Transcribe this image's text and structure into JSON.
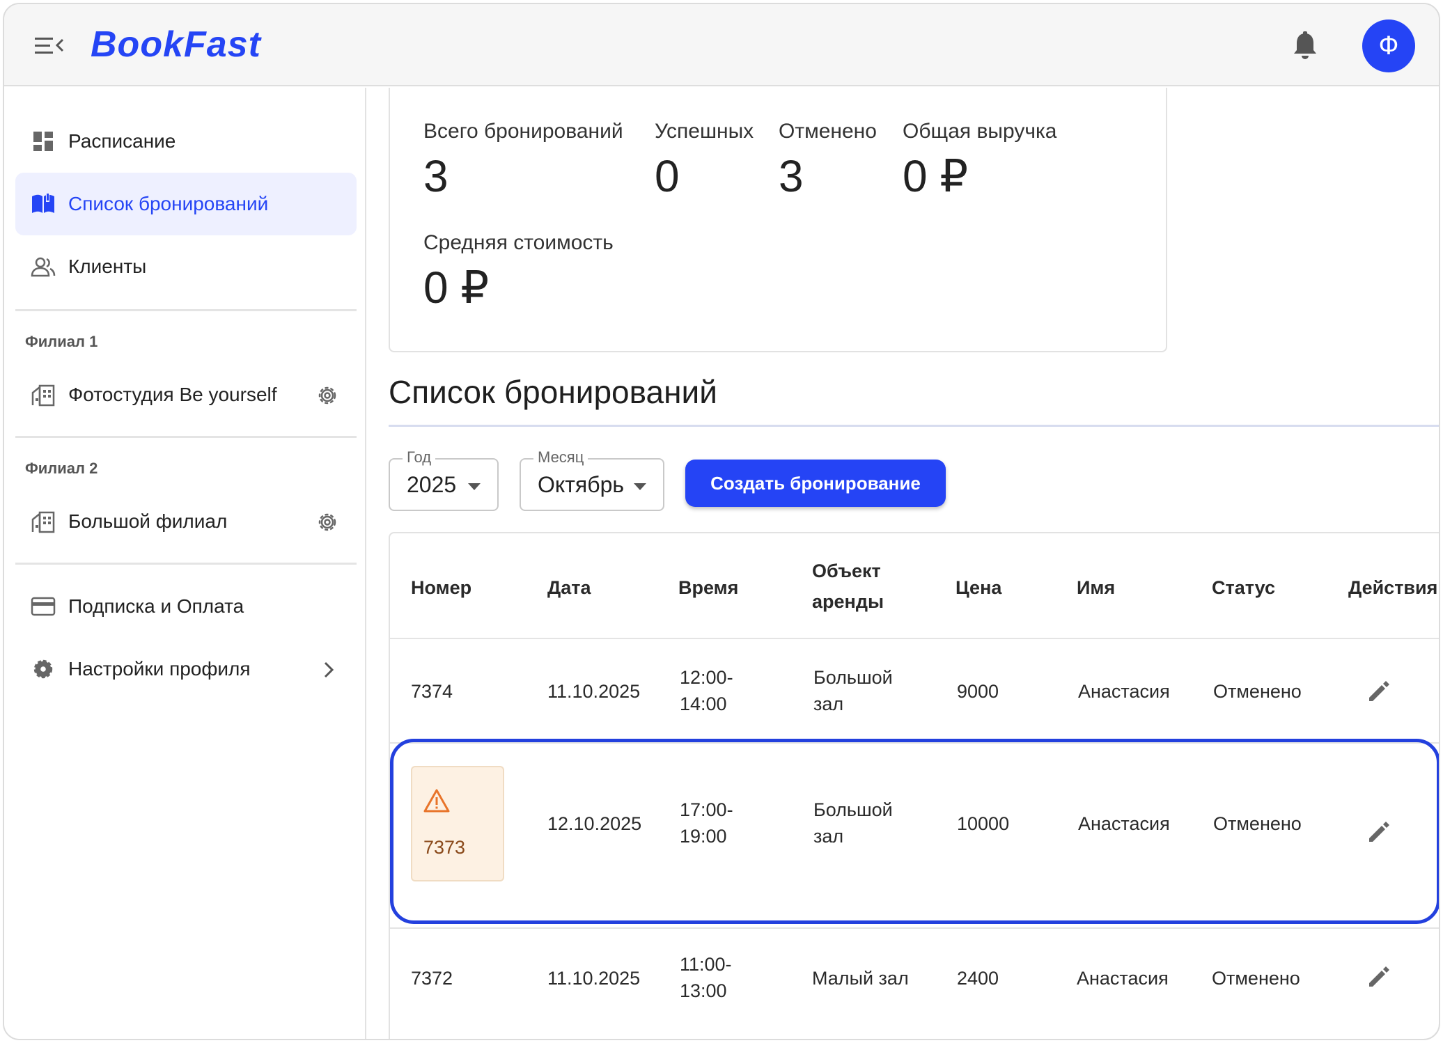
{
  "header": {
    "logo": "BookFast",
    "avatar_initial": "Ф"
  },
  "sidebar": {
    "items": [
      {
        "label": "Расписание"
      },
      {
        "label": "Список бронирований"
      },
      {
        "label": "Клиенты"
      }
    ],
    "branches": [
      {
        "section": "Филиал 1",
        "label": "Фотостудия Be yourself"
      },
      {
        "section": "Филиал 2",
        "label": "Большой филиал"
      }
    ],
    "bottom": [
      {
        "label": "Подписка и Оплата"
      },
      {
        "label": "Настройки профиля"
      }
    ]
  },
  "stats": {
    "total_label": "Всего бронирований",
    "total_value": "3",
    "success_label": "Успешных",
    "success_value": "0",
    "cancelled_label": "Отменено",
    "cancelled_value": "3",
    "revenue_label": "Общая выручка",
    "revenue_value": "0 ₽",
    "avg_label": "Средняя стоимость",
    "avg_value": "0 ₽"
  },
  "bookings": {
    "title": "Список бронирований",
    "year_label": "Год",
    "year_value": "2025",
    "month_label": "Месяц",
    "month_value": "Октябрь",
    "create_label": "Создать бронирование",
    "columns": [
      "Номер",
      "Дата",
      "Время",
      "Объект аренды",
      "Цена",
      "Имя",
      "Статус",
      "Действия"
    ],
    "rows": [
      {
        "number": "7374",
        "date": "11.10.2025",
        "time": "12:00-\n14:00",
        "object": "Большой\nзал",
        "price": "9000",
        "name": "Анастасия",
        "status": "Отменено"
      },
      {
        "number": "7373",
        "date": "12.10.2025",
        "time": "17:00-\n19:00",
        "object": "Большой\nзал",
        "price": "10000",
        "name": "Анастасия",
        "status": "Отменено"
      },
      {
        "number": "7372",
        "date": "11.10.2025",
        "time": "11:00-\n13:00",
        "object": "Малый зал",
        "price": "2400",
        "name": "Анастасия",
        "status": "Отменено"
      }
    ]
  },
  "colors": {
    "accent": "#2545f5",
    "warning": "#e8742a"
  }
}
